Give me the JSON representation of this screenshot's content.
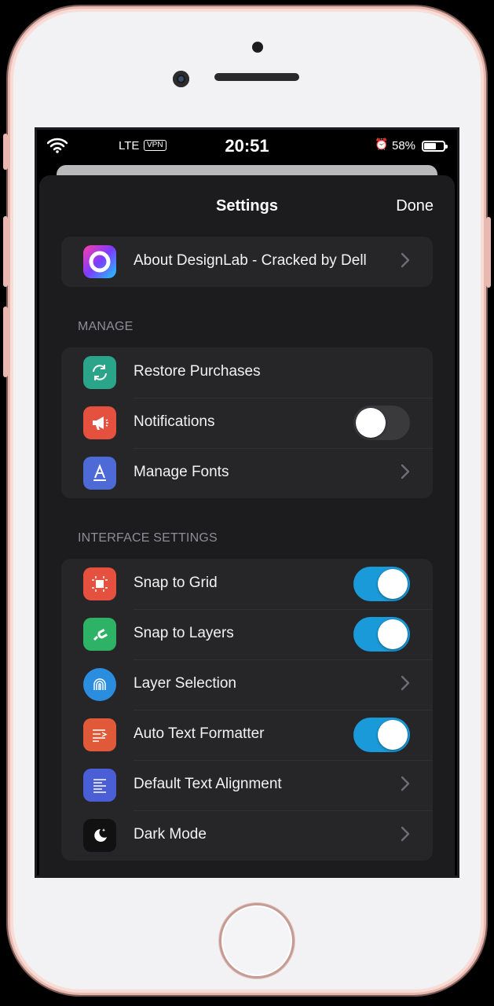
{
  "status_bar": {
    "carrier": "LTE",
    "vpn": "VPN",
    "time": "20:51",
    "battery": "58%",
    "wifi_icon": "wifi-icon",
    "alarm_icon": "alarm-icon"
  },
  "nav": {
    "title": "Settings",
    "done_label": "Done"
  },
  "about": {
    "label": "About DesignLab - Cracked by Dell",
    "icon": "designlab-logo-icon"
  },
  "manage": {
    "header": "MANAGE",
    "items": [
      {
        "label": "Restore Purchases",
        "icon": "restore-icon",
        "color": "#2ba58a",
        "control": "none"
      },
      {
        "label": "Notifications",
        "icon": "megaphone-icon",
        "color": "#e5513e",
        "control": "toggle",
        "on": false
      },
      {
        "label": "Manage Fonts",
        "icon": "font-icon",
        "color": "#4e6ad6",
        "control": "chevron"
      }
    ]
  },
  "interface": {
    "header": "INTERFACE SETTINGS",
    "items": [
      {
        "label": "Snap to Grid",
        "icon": "grid-snap-icon",
        "color": "#e5513e",
        "control": "toggle",
        "on": true
      },
      {
        "label": "Snap to Layers",
        "icon": "magnet-icon",
        "color": "#2eb366",
        "control": "toggle",
        "on": true
      },
      {
        "label": "Layer Selection",
        "icon": "fingerprint-icon",
        "color": "#2a8de0",
        "control": "chevron"
      },
      {
        "label": "Auto Text Formatter",
        "icon": "text-format-icon",
        "color": "#e05a3a",
        "control": "toggle",
        "on": true
      },
      {
        "label": "Default Text Alignment",
        "icon": "align-left-icon",
        "color": "#4a5fd6",
        "control": "chevron"
      },
      {
        "label": "Dark Mode",
        "icon": "moon-icon",
        "color": "#111111",
        "control": "chevron"
      }
    ]
  },
  "colors": {
    "accent_toggle": "#1a9ad9",
    "background": "#1c1c1e",
    "group": "#262628"
  }
}
